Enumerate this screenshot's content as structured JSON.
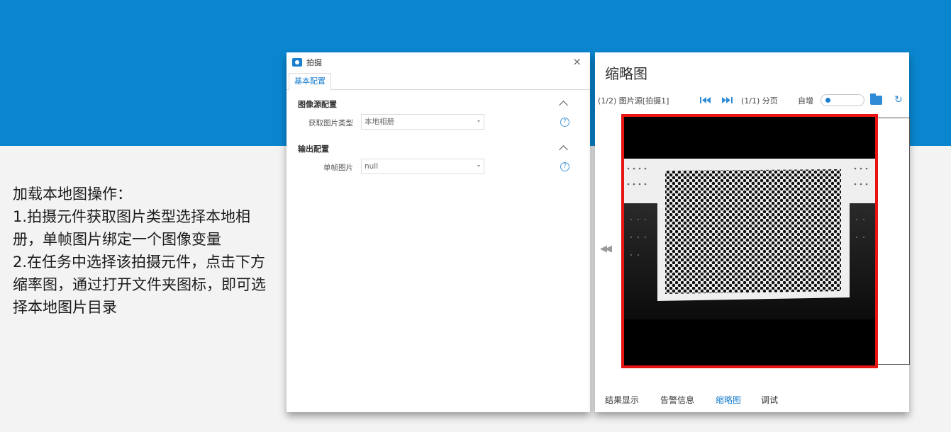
{
  "background": {
    "accent_color": "#0a86cf"
  },
  "instructions": {
    "text": "加载本地图操作：\n1.拍摄元件获取图片类型选择本地相册，单帧图片绑定一个图像变量\n2.在任务中选择该拍摄元件，点击下方缩率图，通过打开文件夹图标，即可选择本地图片目录"
  },
  "config_dialog": {
    "title": "拍摄",
    "tab_label": "基本配置",
    "sections": [
      {
        "title": "图像源配置",
        "field_label": "获取图片类型",
        "field_value": "本地相册"
      },
      {
        "title": "输出配置",
        "field_label": "单帧图片",
        "field_value": "null"
      }
    ],
    "help_glyph": "?",
    "close_glyph": "×"
  },
  "thumbnail_panel": {
    "title": "缩略图",
    "toolbar": {
      "image_source": "(1/2) 图片源[拍摄1]",
      "paging": "(1/1) 分页",
      "auto_increment_label": "自增",
      "auto_increment_on": true
    },
    "bottom_tabs": [
      "结果显示",
      "告警信息",
      "缩略图",
      "调试"
    ],
    "active_tab": "缩略图"
  }
}
